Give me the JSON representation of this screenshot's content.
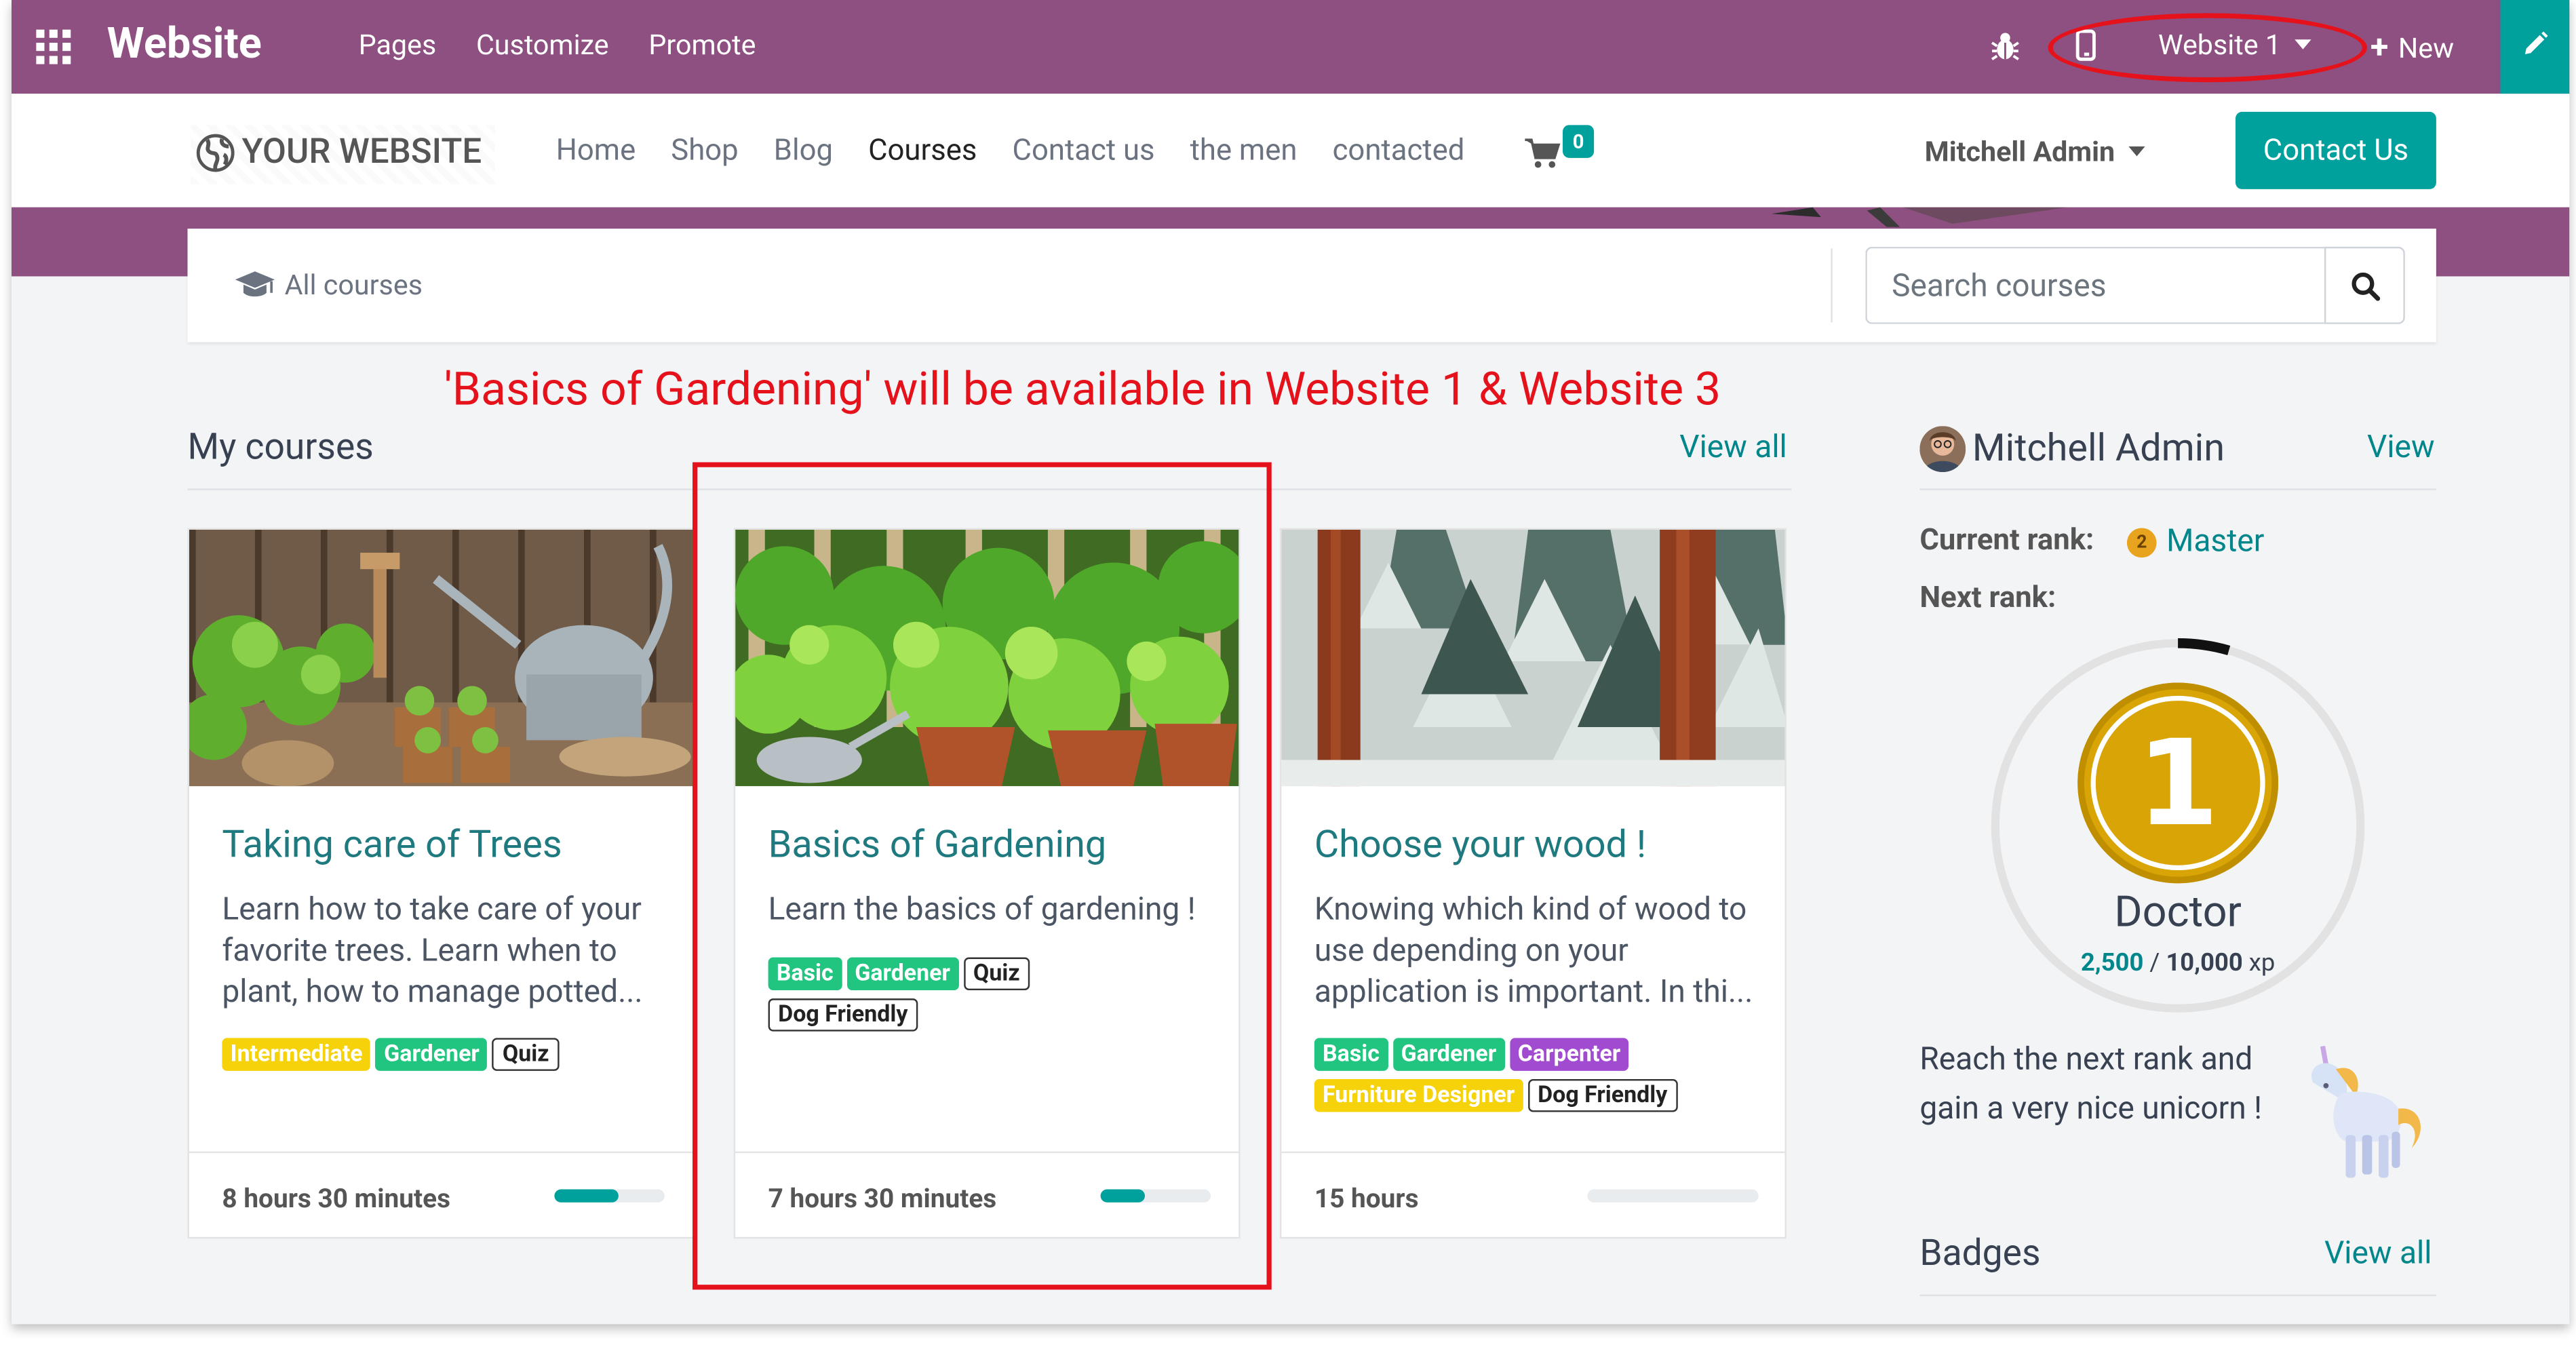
{
  "topbar": {
    "brand": "Website",
    "nav": [
      "Pages",
      "Customize",
      "Promote"
    ],
    "website_selector": "Website 1",
    "new_label": "New",
    "color": "#8e5080"
  },
  "header": {
    "logo_text": "YOUR WEBSITE",
    "nav": [
      "Home",
      "Shop",
      "Blog",
      "Courses",
      "Contact us",
      "the men",
      "contacted"
    ],
    "active_nav": "Courses",
    "cart_count": "0",
    "user": "Mitchell Admin",
    "contact_button": "Contact Us",
    "accent": "#00a09d"
  },
  "search": {
    "all_courses": "All courses",
    "placeholder": "Search courses"
  },
  "annotation": "'Basics of Gardening' will be available in Website 1 & Website 3",
  "my_courses": {
    "title": "My courses",
    "view_all": "View all",
    "courses": [
      {
        "title": "Taking care of Trees",
        "description": "Learn how to take care of your favorite trees. Learn when to plant, how to manage potted...",
        "tags": [
          {
            "label": "Intermediate",
            "color": "yellow"
          },
          {
            "label": "Gardener",
            "color": "green"
          },
          {
            "label": "Quiz",
            "color": "outline"
          }
        ],
        "duration": "8 hours 30 minutes",
        "progress": 0.58
      },
      {
        "title": "Basics of Gardening",
        "description": "Learn the basics of gardening !",
        "tags": [
          {
            "label": "Basic",
            "color": "green"
          },
          {
            "label": "Gardener",
            "color": "green"
          },
          {
            "label": "Quiz",
            "color": "outline"
          },
          {
            "label": "Dog Friendly",
            "color": "outline"
          }
        ],
        "duration": "7 hours 30 minutes",
        "progress": 0.4
      },
      {
        "title": "Choose your wood !",
        "description": "Knowing which kind of wood to use depending on your application is important. In thi...",
        "tags": [
          {
            "label": "Basic",
            "color": "green"
          },
          {
            "label": "Gardener",
            "color": "green"
          },
          {
            "label": "Carpenter",
            "color": "purple"
          },
          {
            "label": "Furniture Designer",
            "color": "yellow"
          },
          {
            "label": "Dog Friendly",
            "color": "outline"
          }
        ],
        "duration": "15 hours",
        "progress": 0
      }
    ]
  },
  "profile": {
    "name": "Mitchell Admin",
    "view_label": "View",
    "current_rank_label": "Current rank:",
    "current_rank_medal": "2",
    "current_rank": "Master",
    "next_rank_label": "Next rank:",
    "next_rank_medal": "1",
    "next_rank_name": "Doctor",
    "xp_current": "2,500",
    "xp_separator": " / ",
    "xp_max": "10,000",
    "xp_unit": " xp",
    "xp_fraction": 0.25,
    "reward": "Reach the next rank and gain a very nice unicorn !",
    "badges_title": "Badges",
    "badges_view_all": "View all"
  },
  "colors": {
    "annotation": "#e5121c",
    "teal_link": "#00868b"
  }
}
